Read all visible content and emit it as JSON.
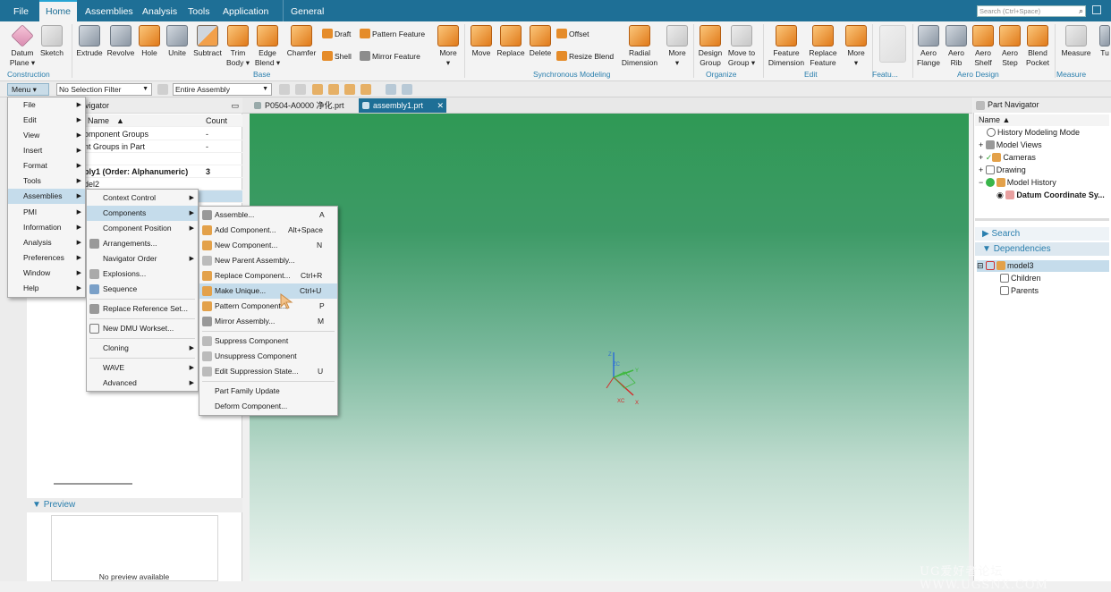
{
  "topbar": {
    "tabs": [
      "File",
      "Home",
      "Assemblies",
      "Analysis",
      "Tools",
      "Application",
      "General"
    ],
    "active_tab": "Home",
    "search_placeholder": "Search (Ctrl+Space)"
  },
  "ribbon": {
    "construction": {
      "datum_plane": "Datum Plane ▾",
      "sketch": "Sketch",
      "group": "Construction"
    },
    "base": {
      "extrude": "Extrude",
      "revolve": "Revolve",
      "hole": "Hole",
      "unite": "Unite",
      "subtract": "Subtract",
      "trim_body": "Trim Body ▾",
      "edge_blend": "Edge Blend ▾",
      "chamfer": "Chamfer",
      "draft": "Draft",
      "shell": "Shell",
      "pattern_feature": "Pattern Feature",
      "mirror_feature": "Mirror Feature",
      "more": "More",
      "group": "Base"
    },
    "sync": {
      "move": "Move",
      "replace": "Replace",
      "delete": "Delete",
      "offset": "Offset",
      "resize_blend": "Resize Blend",
      "radial_dimension": "Radial Dimension",
      "more": "More",
      "group": "Synchronous Modeling"
    },
    "organize": {
      "design_group": "Design Group",
      "move_to_group": "Move to Group ▾",
      "group": "Organize"
    },
    "edit": {
      "feature_dimension": "Feature Dimension",
      "replace_feature": "Replace Feature",
      "more": "More",
      "group": "Edit"
    },
    "feature_group": "Featu...",
    "aero": {
      "flange": "Aero Flange",
      "rib": "Aero Rib",
      "shelf": "Aero Shelf",
      "step": "Aero Step",
      "blend_pocket": "Blend Pocket",
      "group": "Aero Design"
    },
    "measure": {
      "label": "Measure",
      "group": "Measure"
    },
    "cut_label": "Tu"
  },
  "toolbar2": {
    "menu": "Menu ▾",
    "selection_filter": "No Selection Filter",
    "assembly_scope": "Entire Assembly"
  },
  "navigator": {
    "title": "avigator",
    "col_name": "Name",
    "col_count": "Count",
    "rows": [
      {
        "name": "omponent Groups",
        "count": "-"
      },
      {
        "name": "nt Groups in Part",
        "count": "-"
      },
      {
        "name": "",
        "count": ""
      },
      {
        "name": "bly1 (Order: Alphanumeric)",
        "count": "3"
      },
      {
        "name": "del2",
        "count": ""
      }
    ],
    "preview": "Preview",
    "no_preview": "No preview available"
  },
  "doc_tabs": [
    {
      "label": "P0504-A0000 净化.prt",
      "active": false
    },
    {
      "label": "assembly1.prt",
      "active": true
    }
  ],
  "main_menu": [
    "File",
    "Edit",
    "View",
    "Insert",
    "Format",
    "Tools",
    "Assemblies",
    "PMI",
    "Information",
    "Analysis",
    "Preferences",
    "Window",
    "Help"
  ],
  "assemblies_menu": [
    "Context Control",
    "Components",
    "Component Position",
    "Arrangements...",
    "Navigator Order",
    "Explosions...",
    "Sequence",
    "Replace Reference Set...",
    "New DMU Workset...",
    "Cloning",
    "WAVE",
    "Advanced"
  ],
  "components_menu": [
    {
      "label": "Assemble...",
      "shortcut": "A"
    },
    {
      "label": "Add Component...",
      "shortcut": "Alt+Space"
    },
    {
      "label": "New Component...",
      "shortcut": "N"
    },
    {
      "label": "New Parent Assembly...",
      "shortcut": ""
    },
    {
      "label": "Replace Component...",
      "shortcut": "Ctrl+R"
    },
    {
      "label": "Make Unique...",
      "shortcut": "Ctrl+U"
    },
    {
      "label": "Pattern Component...",
      "shortcut": "P"
    },
    {
      "label": "Mirror Assembly...",
      "shortcut": "M"
    },
    {
      "label": "Suppress Component",
      "shortcut": ""
    },
    {
      "label": "Unsuppress Component",
      "shortcut": ""
    },
    {
      "label": "Edit Suppression State...",
      "shortcut": "U"
    },
    {
      "label": "Part Family Update",
      "shortcut": ""
    },
    {
      "label": "Deform Component...",
      "shortcut": ""
    }
  ],
  "part_navigator": {
    "title": "Part Navigator",
    "col_name": "Name",
    "items": [
      "History Modeling Mode",
      "Model Views",
      "Cameras",
      "Drawing",
      "Model History",
      "Datum Coordinate Sy..."
    ],
    "search": "Search",
    "dependencies": "Dependencies",
    "dep_items": [
      "model3",
      "Children",
      "Parents"
    ]
  },
  "triad": {
    "z": "Z",
    "zc": "ZC",
    "y": "Y",
    "yc": "YC",
    "x": "X",
    "xc": "XC"
  },
  "watermark": "UG爱好者论坛 WWW.UGSNX.COM",
  "colors": {
    "accent": "#1e6f96",
    "highlight": "#c5dceb",
    "viewport_top": "#2f9955",
    "viewport_bottom": "#eef6f2"
  }
}
